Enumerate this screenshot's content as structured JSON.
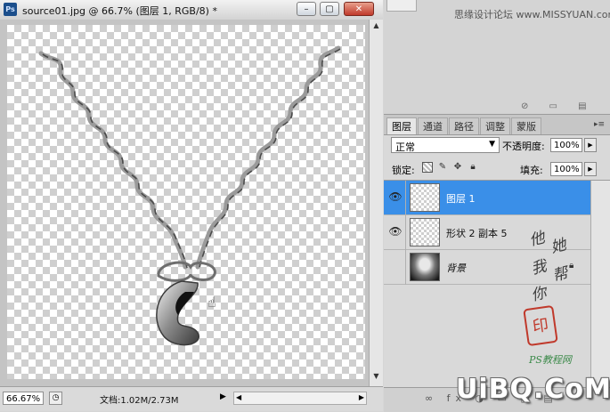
{
  "document": {
    "app_icon_label": "Ps",
    "title": "source01.jpg @ 66.7% (图层 1, RGB/8) *",
    "minimize_glyph": "–",
    "restore_glyph": "▢",
    "close_glyph": "✕"
  },
  "status": {
    "zoom": "66.67%",
    "doc_size": "文档:1.02M/2.73M",
    "menu_arrow": "▶"
  },
  "upper_panel": {
    "watermark": "思缘设计论坛 www.MISSYUAN.com",
    "icons_text": "⊘ ▭ ▤"
  },
  "layers_panel": {
    "tabs": [
      {
        "label": "图层",
        "active": true
      },
      {
        "label": "通道",
        "active": false
      },
      {
        "label": "路径",
        "active": false
      },
      {
        "label": "调整",
        "active": false
      },
      {
        "label": "蒙版",
        "active": false
      }
    ],
    "menu_glyph": "▸≡",
    "blend_mode": "正常",
    "opacity_label": "不透明度:",
    "opacity_value": "100%",
    "lock_label": "锁定:",
    "fill_label": "填充:",
    "fill_value": "100%",
    "layers": [
      {
        "name": "图层 1",
        "visible": true,
        "selected": true,
        "thumb": "transparent",
        "locked": false
      },
      {
        "name": "形状 2 副本 5",
        "visible": true,
        "selected": false,
        "thumb": "transparent",
        "locked": false
      },
      {
        "name": "背景",
        "visible": false,
        "selected": false,
        "thumb": "photo",
        "locked": true
      }
    ],
    "bottom_icons": "∞ fx ◑ ▭ ▣ ▤"
  },
  "overlay": {
    "calligraphy_chars": [
      "他",
      "她",
      "我",
      "帮",
      "你"
    ],
    "seal_char": "印",
    "ps_signature": "PS教程网",
    "brand": "UiBQ.CoM"
  },
  "colors": {
    "selection": "#3a8fe8",
    "seal": "#c0392b"
  }
}
